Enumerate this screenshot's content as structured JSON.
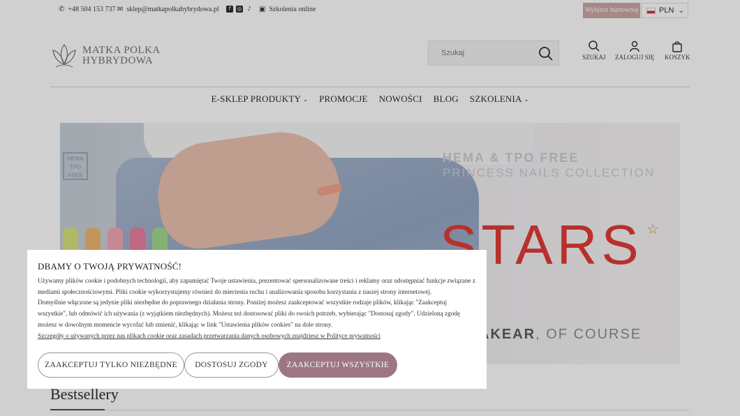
{
  "topbar": {
    "phone": "+48 504 153 737",
    "email": "sklep@matkapolkahybrydowa.pl",
    "social": [
      "facebook-icon",
      "instagram-icon",
      "tiktok-icon"
    ],
    "training_online": "Szkolenia online",
    "wholesale": "Wybierz hurtownię",
    "currency": "PLN"
  },
  "header": {
    "logo_line1": "MATKA POLKA",
    "logo_line2": "HYBRYDOWA",
    "search_placeholder": "Szukaj",
    "icons": {
      "search": "SZUKAJ",
      "login": "ZALOGUJ SIĘ",
      "cart": "KOSZYK"
    }
  },
  "nav": {
    "items": [
      {
        "label": "E-SKLEP PRODUKTY",
        "has_dropdown": true
      },
      {
        "label": "PROMOCJE",
        "has_dropdown": false
      },
      {
        "label": "NOWOŚCI",
        "has_dropdown": false
      },
      {
        "label": "BLOG",
        "has_dropdown": false
      },
      {
        "label": "SZKOLENIA",
        "has_dropdown": true
      }
    ]
  },
  "hero": {
    "badge": "HEMA TPO FREE",
    "line1": "HEMA & TPO FREE",
    "line2": "PRINCESS NAILS COLLECTION",
    "headline": "STARS",
    "tagline_brand": "AKEAR",
    "tagline_rest": ", OF COURSE"
  },
  "bestsellers": {
    "title": "Bestsellery"
  },
  "cookie": {
    "title": "DBAMY O TWOJĄ PRYWATNOŚĆ!",
    "para1": "Używamy plików cookie i podobnych technologii, aby zapamiętać Twoje ustawienia, prezentować spersonalizowane treści i reklamy oraz udostępniać funkcje związane z mediami społecznościowymi. Pliki cookie wykorzystujemy również do mierzenia ruchu i analizowania sposobu korzystania z naszej strony internetowej.",
    "para2": "Domyślnie włączone są jedynie pliki niezbędne do poprawnego działania strony. Poniżej możesz zaakceptować wszystkie rodzaje plików, klikając \"Zaakceptuj wszystkie\", lub odmówić ich używania (z wyjątkiem niezbędnych). Możesz też dostosować pliki do swoich potrzeb, wybierając \"Dostosuj zgody\". Udzieloną zgodę możesz w dowolnym momencie wycofać lub zmienić, klikając w link \"Ustawienia plików cookies\" na dole strony.",
    "policy_link": "Szczegóły o używanych przez nas plikach cookie oraz zasadach przetwarzania danych osobowych znajdziesz w Polityce prywatności",
    "btn_necessary": "ZAAKCEPTUJ TYLKO NIEZBĘDNE",
    "btn_customize": "DOSTOSUJ ZGODY",
    "btn_accept_all": "ZAAKCEPTUJ WSZYSTKIE"
  },
  "colors": {
    "accent": "#9c7781",
    "wholesale_bg": "#c9a39e",
    "stars_red": "#e0332e"
  }
}
